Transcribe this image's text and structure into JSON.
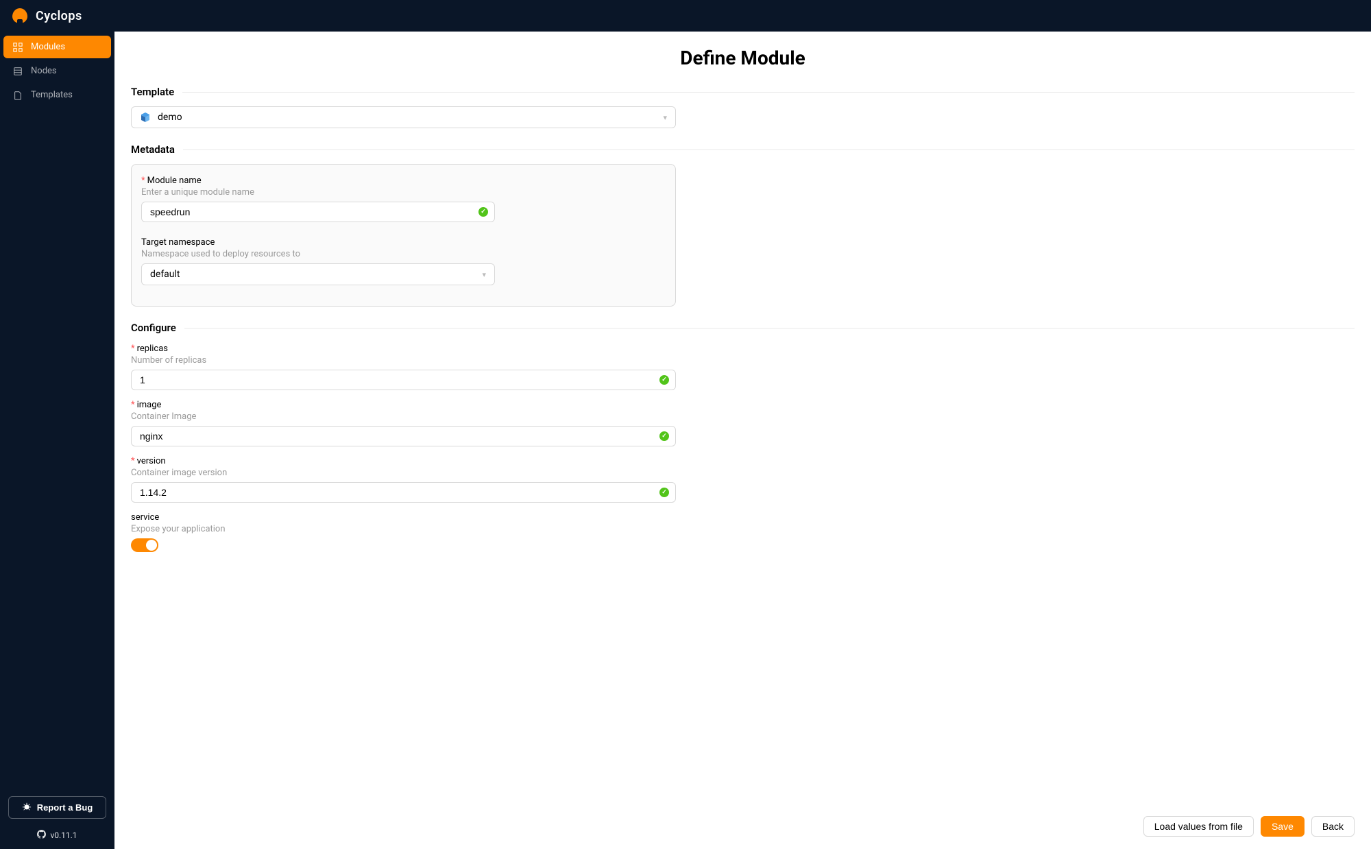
{
  "brand": "Cyclops",
  "sidebar": {
    "items": [
      {
        "label": "Modules",
        "icon": "modules-icon",
        "active": true
      },
      {
        "label": "Nodes",
        "icon": "nodes-icon",
        "active": false
      },
      {
        "label": "Templates",
        "icon": "templates-icon",
        "active": false
      }
    ],
    "bug_label": "Report a Bug",
    "version": "v0.11.1"
  },
  "page": {
    "title": "Define Module",
    "sections": {
      "template": {
        "heading": "Template",
        "value": "demo"
      },
      "metadata": {
        "heading": "Metadata",
        "module_name": {
          "label": "Module name",
          "help": "Enter a unique module name",
          "value": "speedrun",
          "required": true
        },
        "namespace": {
          "label": "Target namespace",
          "help": "Namespace used to deploy resources to",
          "value": "default"
        }
      },
      "configure": {
        "heading": "Configure",
        "replicas": {
          "label": "replicas",
          "help": "Number of replicas",
          "value": "1",
          "required": true
        },
        "image": {
          "label": "image",
          "help": "Container Image",
          "value": "nginx",
          "required": true
        },
        "version": {
          "label": "version",
          "help": "Container image version",
          "value": "1.14.2",
          "required": true
        },
        "service": {
          "label": "service",
          "help": "Expose your application",
          "on": true
        }
      }
    },
    "actions": {
      "load": "Load values from file",
      "save": "Save",
      "back": "Back"
    }
  }
}
